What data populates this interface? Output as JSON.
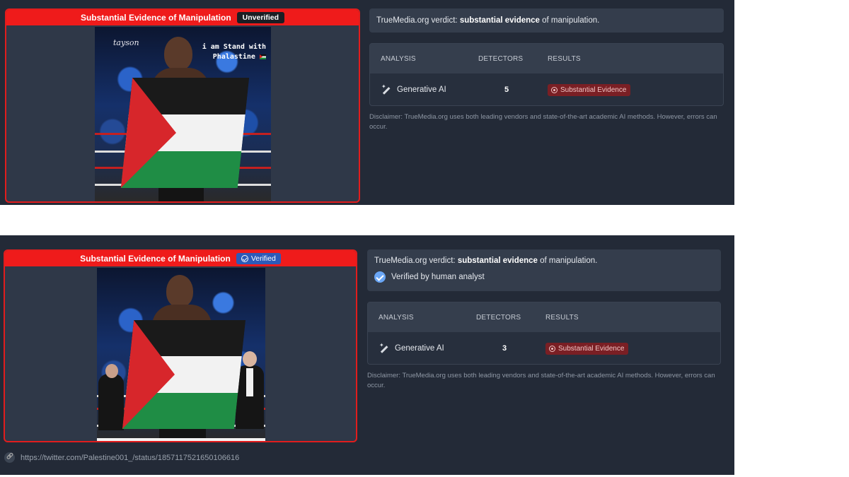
{
  "result_top": {
    "card_title": "Substantial Evidence of Manipulation",
    "status_badge": "Unverified",
    "image_overlay_text_line1": "i am Stand with",
    "image_overlay_text_line2": "Phalastine",
    "image_signature": "tayson",
    "verdict_prefix": "TrueMedia.org verdict: ",
    "verdict_bold": "substantial evidence",
    "verdict_suffix": " of manipulation.",
    "table": {
      "headers": [
        "ANALYSIS",
        "DETECTORS",
        "RESULTS"
      ],
      "row": {
        "analysis": "Generative AI",
        "detectors": "5",
        "result": "Substantial Evidence"
      }
    },
    "disclaimer": "Disclaimer: TrueMedia.org uses both leading vendors and state-of-the-art academic AI methods. However, errors can occur."
  },
  "result_bottom": {
    "card_title": "Substantial Evidence of Manipulation",
    "status_badge": "Verified",
    "verdict_prefix": "TrueMedia.org verdict: ",
    "verdict_bold": "substantial evidence",
    "verdict_suffix": " of manipulation.",
    "verified_note": "Verified by human analyst",
    "table": {
      "headers": [
        "ANALYSIS",
        "DETECTORS",
        "RESULTS"
      ],
      "row": {
        "analysis": "Generative AI",
        "detectors": "3",
        "result": "Substantial Evidence"
      }
    },
    "disclaimer": "Disclaimer: TrueMedia.org uses both leading vendors and state-of-the-art academic AI methods. However, errors can occur.",
    "source_url": "https://twitter.com/Palestine001_/status/1857117521650106616"
  },
  "colors": {
    "danger": "#ef1b1b",
    "panel_bg": "#232a37",
    "verified_blue": "#2c5ab8",
    "evidence_pill": "#7a1f24"
  },
  "icons": [
    "check-circle-icon",
    "magic-wand-icon",
    "ring-icon",
    "verified-badge-icon",
    "link-icon",
    "palestine-flag-emoji-icon"
  ]
}
